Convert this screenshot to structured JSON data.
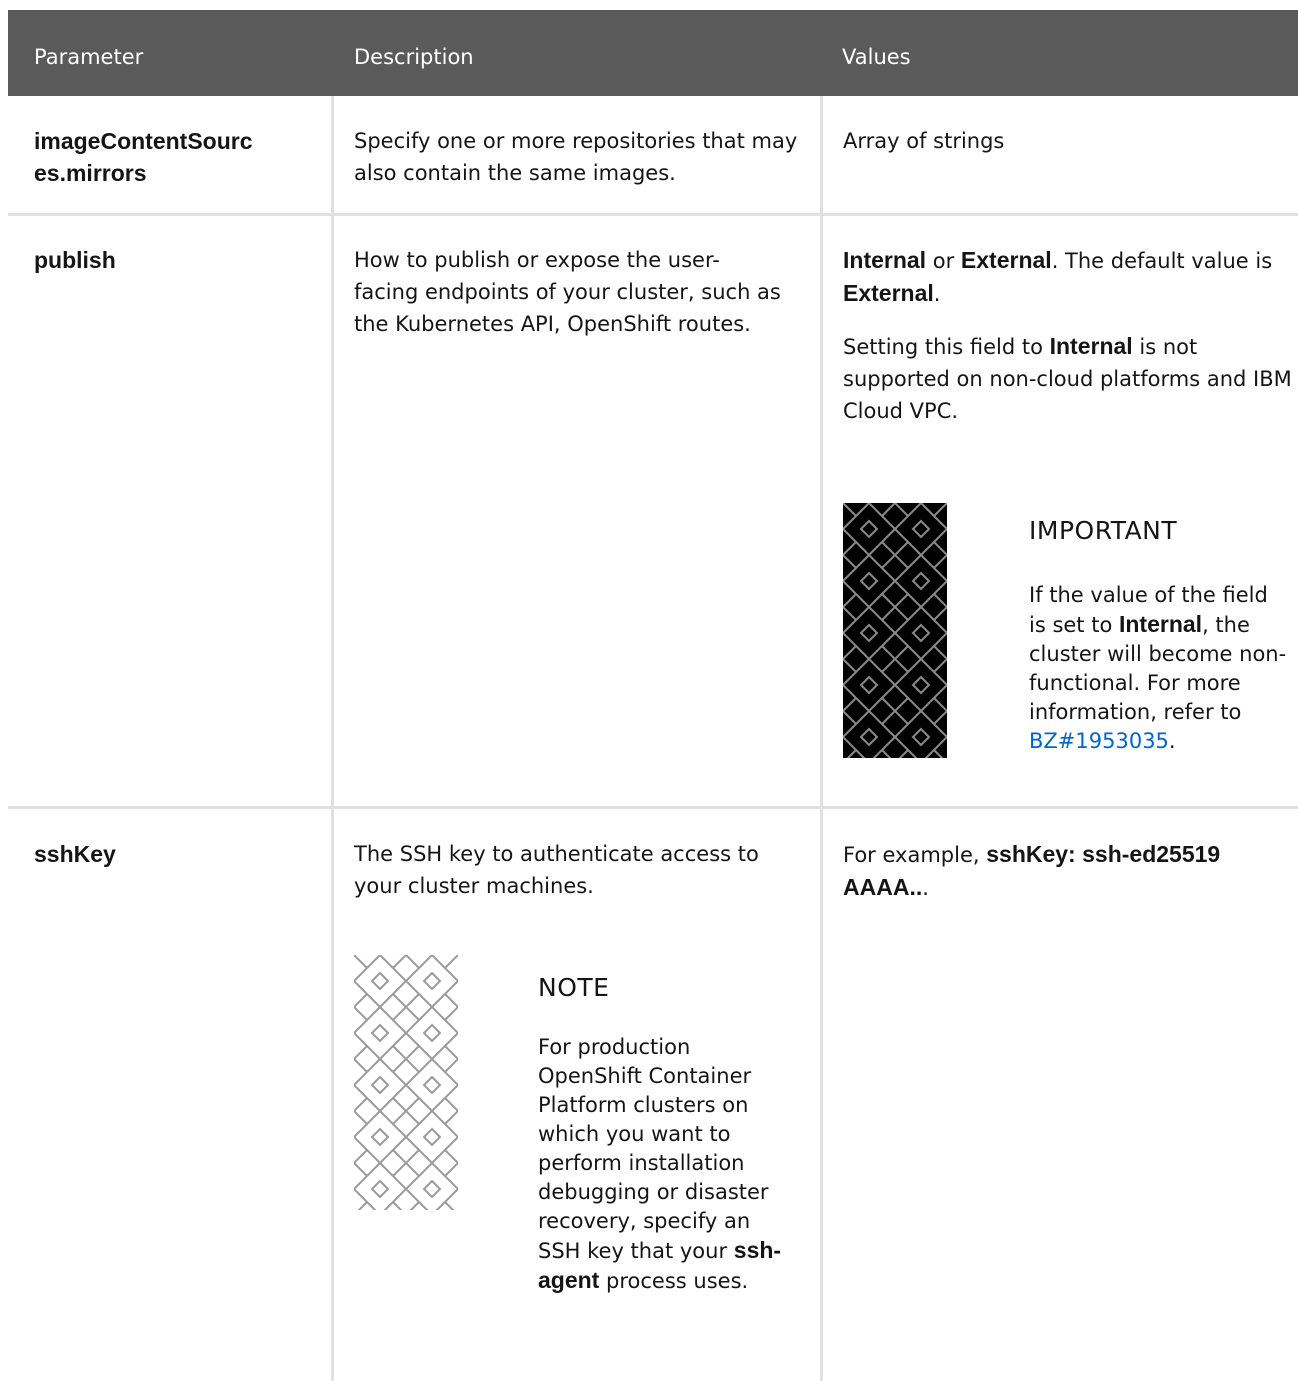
{
  "table": {
    "headers": {
      "parameter": "Parameter",
      "description": "Description",
      "values": "Values"
    },
    "rows": [
      {
        "parameter": "imageContentSources.mirrors",
        "parameter_line1": "imageContentSourc",
        "parameter_line2": "es.mirrors",
        "description": "Specify one or more repositories that may also contain the same images.",
        "values": "Array of strings"
      },
      {
        "parameter": "publish",
        "description": "How to publish or expose the user-facing endpoints of your cluster, such as the Kubernetes API, OpenShift routes.",
        "values": {
          "p1_internal": "Internal",
          "p1_or": " or ",
          "p1_external": "External",
          "p1_mid": ". The default value is ",
          "p1_external2": "External",
          "p1_end": ".",
          "p2_start": "Setting this field to ",
          "p2_internal": "Internal",
          "p2_end": " is not supported on non-cloud platforms and IBM Cloud VPC.",
          "admonition": {
            "title": "IMPORTANT",
            "body_start": "If the value of the field is set to ",
            "body_internal": "Internal",
            "body_mid": ", the cluster will become non-functional. For more information, refer to ",
            "link_text": "BZ#1953035",
            "body_end": "."
          }
        }
      },
      {
        "parameter": "sshKey",
        "description": {
          "text": "The SSH key to authenticate access to your cluster machines.",
          "admonition": {
            "title": "NOTE",
            "body_start": "For production OpenShift Container Platform clusters on which you want to perform installation debugging or disaster recovery, specify an SSH key that your ",
            "body_code": "ssh-agent",
            "body_end": " process uses."
          }
        },
        "values": {
          "prefix": "For example, ",
          "code": "sshKey: ssh-ed25519 AAAA..",
          "suffix": "."
        }
      }
    ]
  },
  "colors": {
    "header_bg": "#5a5a5a",
    "header_text": "#ffffff",
    "grid_line": "#e0e0e0",
    "link": "#0066cc",
    "important_icon_bg": "#000000",
    "note_icon_bg": "#ffffff"
  },
  "icons": {
    "important": "important-diamond-pattern-icon",
    "note": "note-diamond-pattern-icon"
  }
}
